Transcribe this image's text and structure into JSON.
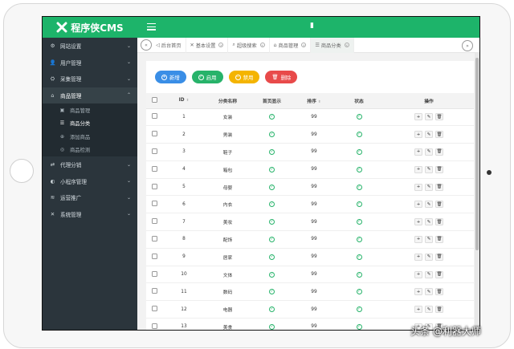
{
  "app": {
    "logo_text": "程序侠CMS",
    "top_indicator": "▮"
  },
  "sidebar": {
    "items": [
      {
        "icon": "⚙",
        "label": "网站设置",
        "chev": "⌄"
      },
      {
        "icon": "👤",
        "label": "用户管理",
        "chev": "⌄"
      },
      {
        "icon": "⛭",
        "label": "采集管理",
        "chev": "⌄"
      },
      {
        "icon": "⌂",
        "label": "商品管理",
        "chev": "⌃"
      },
      {
        "icon": "⇄",
        "label": "代理分销",
        "chev": "⌄"
      },
      {
        "icon": "◐",
        "label": "小程序管理",
        "chev": "⌄"
      },
      {
        "icon": "≋",
        "label": "运营推广",
        "chev": "⌄"
      },
      {
        "icon": "✕",
        "label": "系统管理",
        "chev": "⌄"
      }
    ],
    "subitems": [
      {
        "icon": "▣",
        "label": "商品管理"
      },
      {
        "icon": "☰",
        "label": "商品分类"
      },
      {
        "icon": "⊕",
        "label": "添加商品"
      },
      {
        "icon": "◎",
        "label": "商品检测"
      }
    ]
  },
  "tabs": {
    "prev": "«",
    "next": "»",
    "items": [
      {
        "icon": "◁",
        "label": "后台首页",
        "close": ""
      },
      {
        "icon": "✕",
        "label": "基本设置",
        "close": "×"
      },
      {
        "icon": "⌕",
        "label": "超级搜索",
        "close": "×"
      },
      {
        "icon": "⌂",
        "label": "商品管理",
        "close": "×"
      },
      {
        "icon": "☰",
        "label": "商品分类",
        "close": "×"
      }
    ]
  },
  "toolbar": {
    "add_icon": "+",
    "add": "新增",
    "enable_icon": "✓",
    "enable": "启用",
    "disable_icon": "−",
    "disable": "禁用",
    "delete_icon": "🗑",
    "delete": "删除"
  },
  "table": {
    "headers": {
      "id": "ID",
      "name": "分类名称",
      "show": "首页显示",
      "order": "排序",
      "status": "状态",
      "ops": "操作",
      "sort_icon": "⬍"
    },
    "check_icon": "✓",
    "op_icons": {
      "add": "+",
      "edit": "✎",
      "delete": "🗑"
    },
    "rows": [
      {
        "id": "1",
        "name": "女装",
        "order": "99"
      },
      {
        "id": "2",
        "name": "男装",
        "order": "99"
      },
      {
        "id": "3",
        "name": "鞋子",
        "order": "99"
      },
      {
        "id": "4",
        "name": "箱包",
        "order": "99"
      },
      {
        "id": "5",
        "name": "母婴",
        "order": "99"
      },
      {
        "id": "6",
        "name": "内衣",
        "order": "99"
      },
      {
        "id": "7",
        "name": "美妆",
        "order": "99"
      },
      {
        "id": "8",
        "name": "配饰",
        "order": "99"
      },
      {
        "id": "9",
        "name": "居家",
        "order": "99"
      },
      {
        "id": "10",
        "name": "文体",
        "order": "99"
      },
      {
        "id": "11",
        "name": "数码",
        "order": "99"
      },
      {
        "id": "12",
        "name": "电器",
        "order": "99"
      },
      {
        "id": "13",
        "name": "美食",
        "order": "99"
      }
    ]
  },
  "watermark": "头条 @利器大师",
  "colors": {
    "brand_green": "#1db46a",
    "sidebar_bg": "#2b353c",
    "btn_blue": "#3a8ee6",
    "btn_yellow": "#f4b400",
    "btn_red": "#e84a4a"
  }
}
